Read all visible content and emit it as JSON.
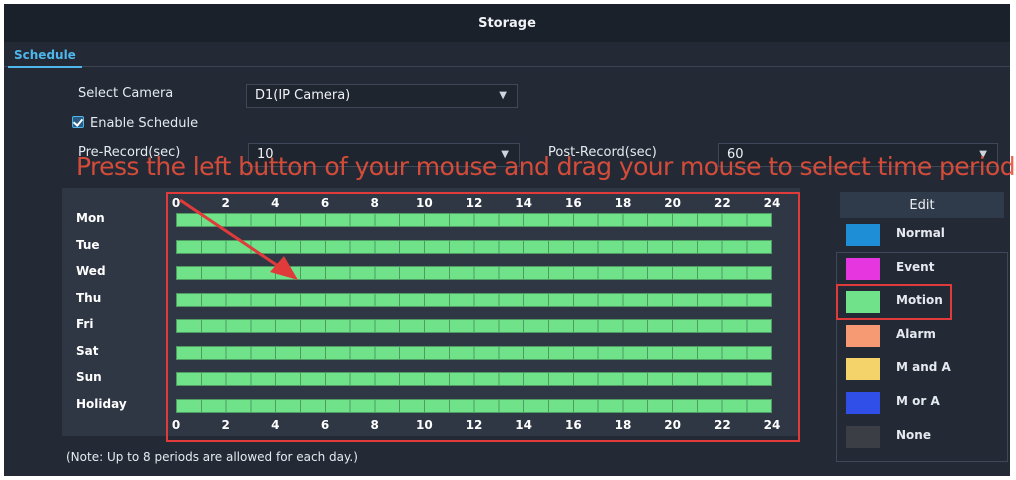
{
  "window": {
    "title": "Storage"
  },
  "tabs": [
    {
      "label": "Schedule"
    }
  ],
  "form": {
    "select_camera_label": "Select Camera",
    "camera_value": "D1(IP Camera)",
    "enable_schedule_label": "Enable Schedule",
    "enable_schedule_checked": true,
    "pre_record_label": "Pre-Record(sec)",
    "pre_record_value": "10",
    "post_record_label": "Post-Record(sec)",
    "post_record_value": "60"
  },
  "instruction": "Press the left button of your mouse and drag your mouse to select  time period",
  "schedule": {
    "hour_ticks": [
      "0",
      "2",
      "4",
      "6",
      "8",
      "10",
      "12",
      "14",
      "16",
      "18",
      "20",
      "22",
      "24"
    ],
    "days": [
      "Mon",
      "Tue",
      "Wed",
      "Thu",
      "Fri",
      "Sat",
      "Sun",
      "Holiday"
    ],
    "fill_type": "Motion"
  },
  "legend": {
    "edit_label": "Edit",
    "items": [
      {
        "label": "Normal",
        "color": "#1e8fd6"
      },
      {
        "label": "Event",
        "color": "#e636e0"
      },
      {
        "label": "Motion",
        "color": "#6fe28a"
      },
      {
        "label": "Alarm",
        "color": "#f59a72"
      },
      {
        "label": "M and A",
        "color": "#f4d46a"
      },
      {
        "label": "M or A",
        "color": "#2f4fe8"
      },
      {
        "label": "None",
        "color": "#3b3f45"
      }
    ],
    "highlighted": "Motion"
  },
  "note": "(Note: Up to 8 periods are allowed for each day.)",
  "colors": {
    "accent": "#4fb6ec",
    "highlight_red": "#e03a3a",
    "motion_green": "#6fe28a"
  }
}
